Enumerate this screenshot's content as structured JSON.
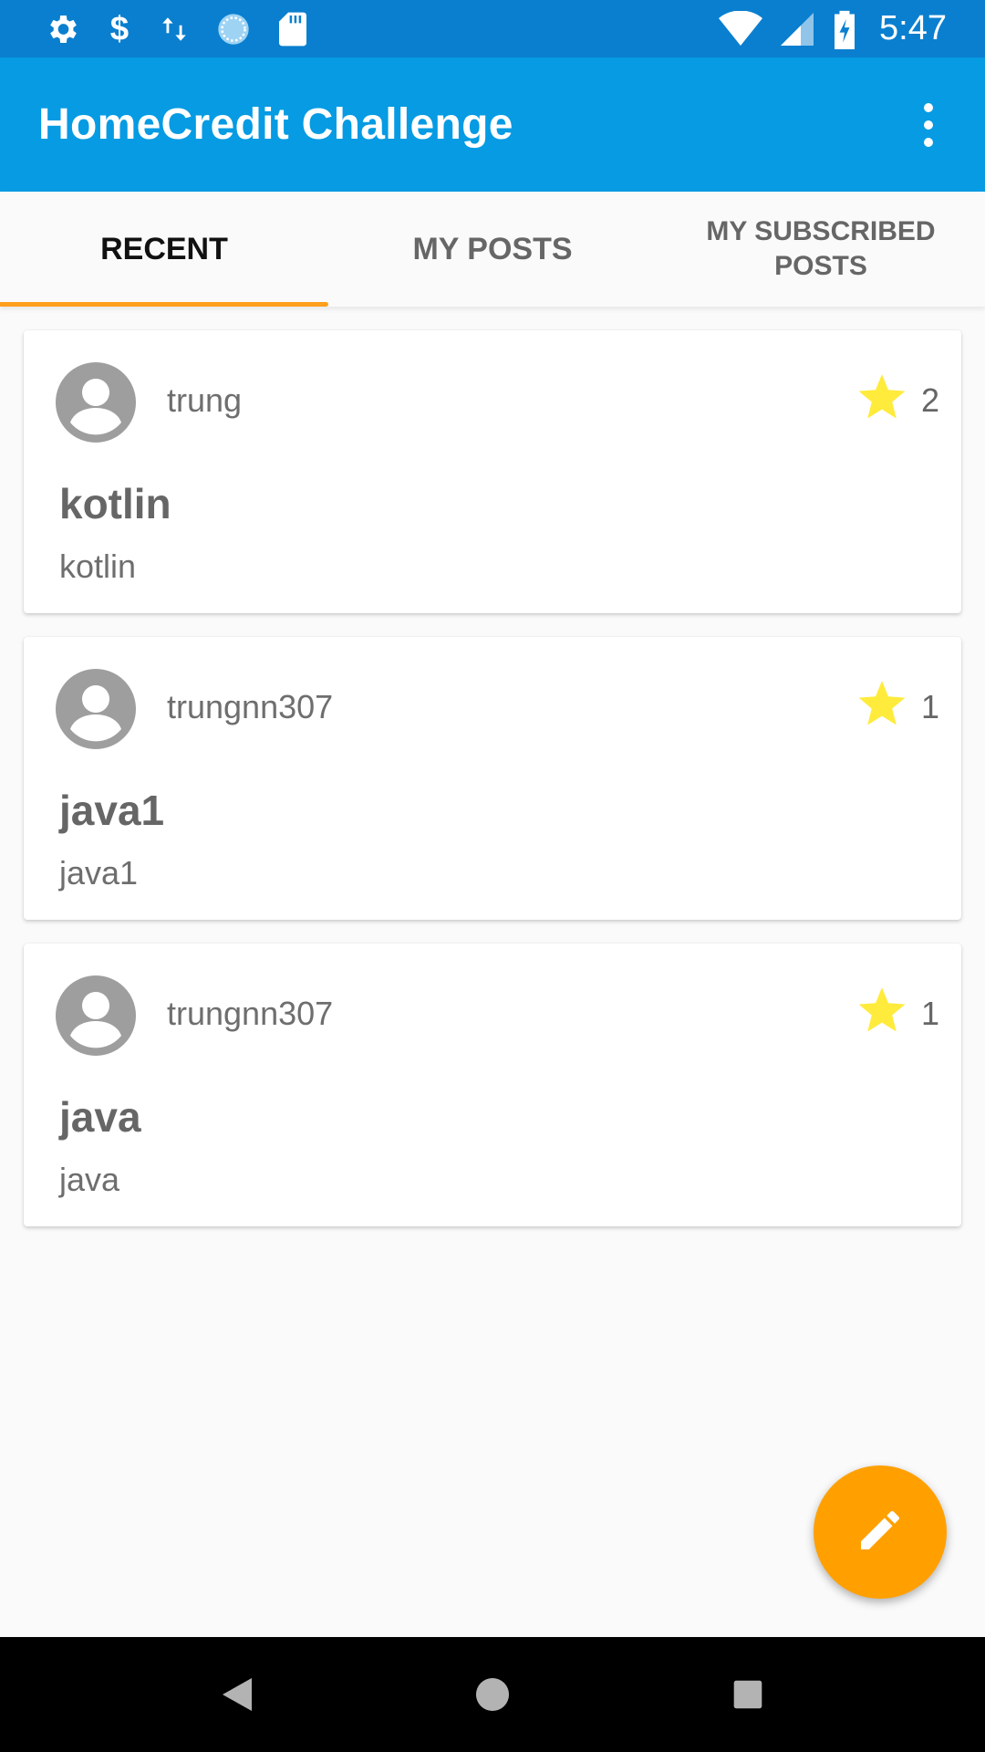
{
  "status_bar": {
    "time": "5:47",
    "left_icons": [
      "gear-icon",
      "dollar-icon",
      "data-transfer-icon",
      "sync-icon",
      "sd-card-icon"
    ],
    "right_icons": [
      "wifi-icon",
      "cell-signal-icon",
      "battery-charging-icon"
    ]
  },
  "app_bar": {
    "title": "HomeCredit Challenge",
    "overflow_icon": "more-vert-icon",
    "background_color": "#069be3"
  },
  "tabs": [
    {
      "label": "RECENT",
      "active": true
    },
    {
      "label": "MY POSTS",
      "active": false
    },
    {
      "label": "MY SUBSCRIBED POSTS",
      "active": false
    }
  ],
  "tab_indicator_color": "#ff9f1c",
  "posts": [
    {
      "author": "trung",
      "stars": "2",
      "title": "kotlin",
      "body": "kotlin"
    },
    {
      "author": "trungnn307",
      "stars": "1",
      "title": "java1",
      "body": "java1"
    },
    {
      "author": "trungnn307",
      "stars": "1",
      "title": "java",
      "body": "java"
    }
  ],
  "star_color": "#ffeb3b",
  "fab": {
    "icon": "pencil-icon",
    "color": "#ffa000"
  },
  "nav_bar": {
    "buttons": [
      "back-icon",
      "home-icon",
      "recents-icon"
    ]
  }
}
